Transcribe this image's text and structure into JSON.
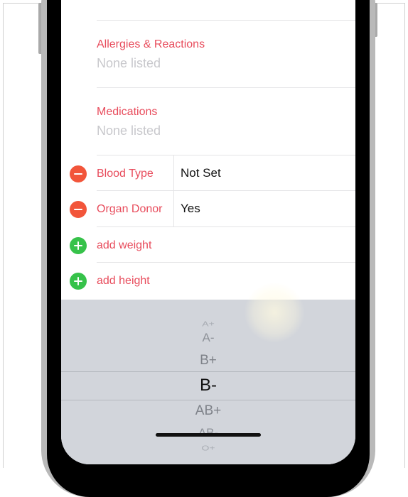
{
  "health_fields": [
    {
      "label": "Allergies & Reactions",
      "value": "None listed"
    },
    {
      "label": "Medications",
      "value": "None listed"
    }
  ],
  "detail_rows": [
    {
      "label": "Blood Type",
      "value": "Not Set",
      "action": "remove"
    },
    {
      "label": "Organ Donor",
      "value": "Yes",
      "action": "remove"
    }
  ],
  "add_rows": [
    {
      "label": "add weight",
      "action": "add"
    },
    {
      "label": "add height",
      "action": "add"
    }
  ],
  "picker": {
    "items": [
      "A+",
      "A-",
      "B+",
      "B-",
      "AB+",
      "AB-",
      "O+"
    ],
    "selected": "B-"
  },
  "colors": {
    "accent_red": "#e84c5c",
    "remove_button": "#f2553a",
    "add_button": "#36c24a",
    "placeholder": "#c8c8cc",
    "picker_bg": "#d2d5db"
  }
}
